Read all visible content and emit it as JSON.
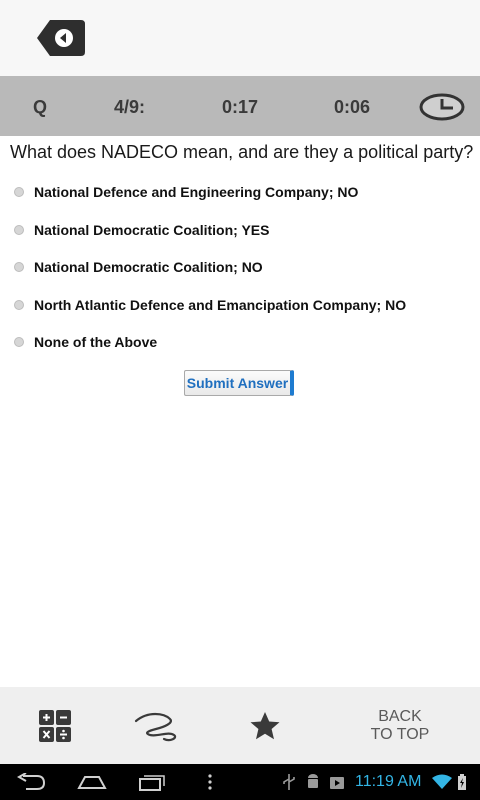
{
  "header": {
    "back_icon": "back-arrow-icon"
  },
  "quiz_bar": {
    "label": "Q",
    "progress": "4/9:",
    "timer_question": "0:17",
    "timer_total": "0:06",
    "clock_icon": "clock-icon"
  },
  "question": {
    "text": "What does NADECO mean, and are they a political party?",
    "options": [
      "National Defence and Engineering Company; NO",
      "National Democratic Coalition; YES",
      "National Democratic Coalition; NO",
      "North Atlantic Defence and Emancipation Company; NO",
      "None of the Above"
    ],
    "submit_label": "Submit Answer"
  },
  "toolbar": {
    "calculator_icon": "calculator-icon",
    "scribble_icon": "scribble-icon",
    "star_icon": "star-icon",
    "back_to_top_line1": "BACK",
    "back_to_top_line2": "TO TOP"
  },
  "system_bar": {
    "time": "11:19 AM",
    "colors": {
      "accent": "#33b5e5",
      "background": "#000000"
    }
  }
}
